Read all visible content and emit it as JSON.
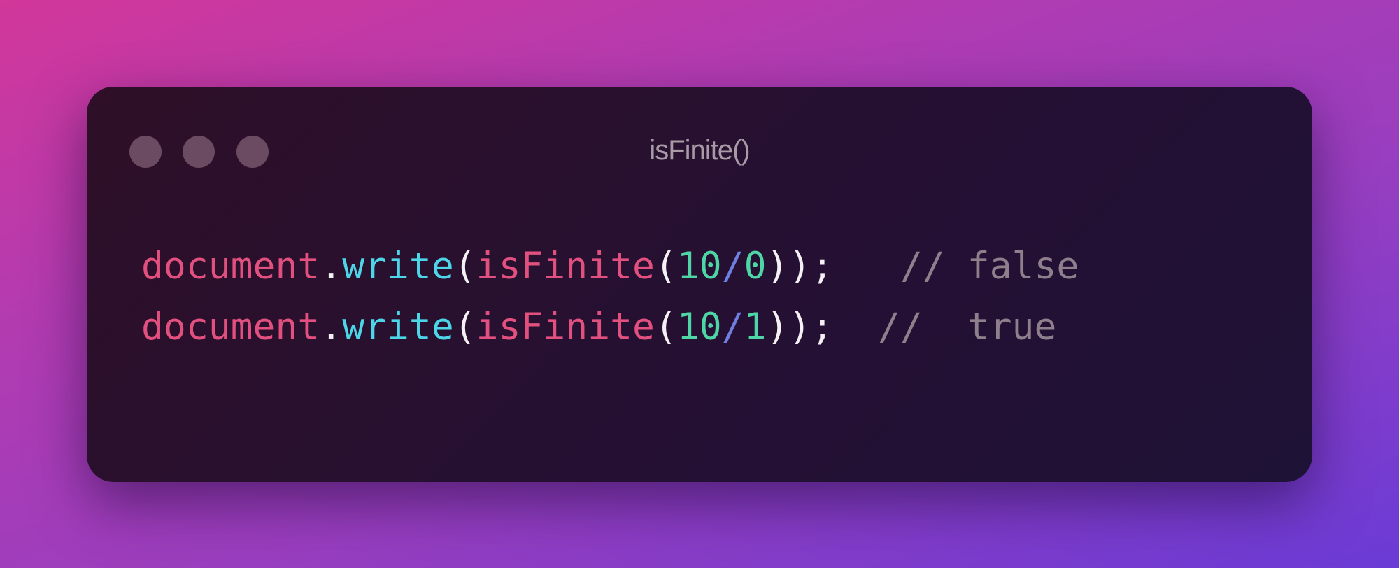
{
  "window": {
    "title": "isFinite()"
  },
  "code_lines": [
    {
      "obj": "document",
      "dot": ".",
      "method": "write",
      "open1": "(",
      "fn": "isFinite",
      "open2": "(",
      "num1": "10",
      "op": "/",
      "num2": "0",
      "close": "));",
      "comment": "   // false"
    },
    {
      "obj": "document",
      "dot": ".",
      "method": "write",
      "open1": "(",
      "fn": "isFinite",
      "open2": "(",
      "num1": "10",
      "op": "/",
      "num2": "1",
      "close": "));",
      "comment": "  //  true"
    }
  ]
}
